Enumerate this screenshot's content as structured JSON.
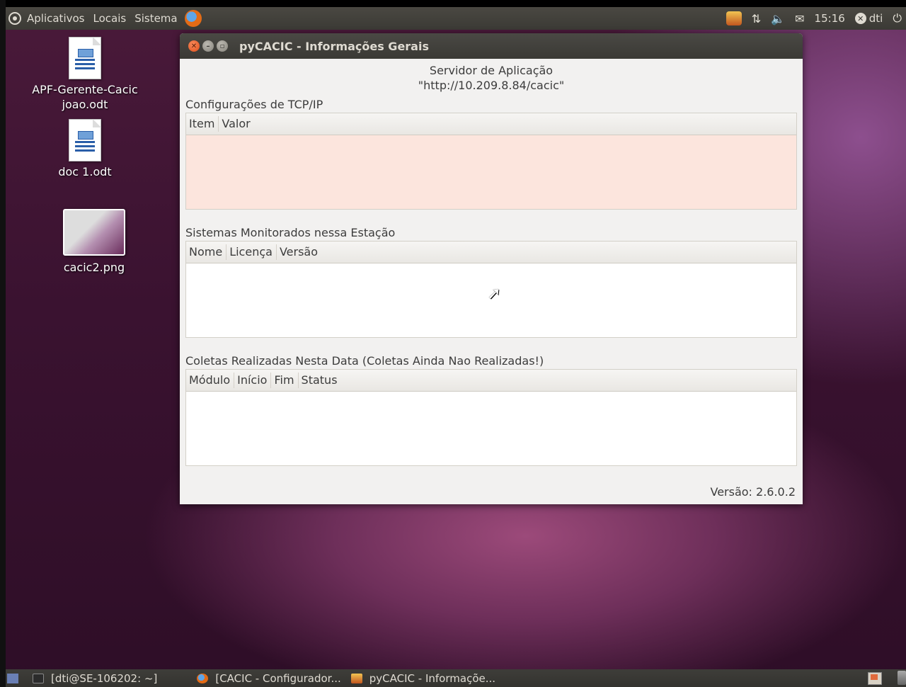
{
  "top_panel": {
    "menus": [
      "Aplicativos",
      "Locais",
      "Sistema"
    ],
    "clock": "15:16",
    "user": "dti"
  },
  "desktop": {
    "icons": [
      {
        "label_line1": "APF-Gerente-Cacic",
        "label_line2": "joao.odt"
      },
      {
        "label_line1": "doc 1.odt"
      },
      {
        "label_line1": "cacic2.png"
      }
    ]
  },
  "window": {
    "title": "pyCACIC - Informações Gerais",
    "server_label": "Servidor de Aplicação",
    "server_url": "\"http://10.209.8.84/cacic\"",
    "tcp_section": "Configurações de TCP/IP",
    "tcp_columns": [
      "Item",
      "Valor"
    ],
    "systems_section": "Sistemas Monitorados nessa Estação",
    "systems_columns": [
      "Nome",
      "Licença",
      "Versão"
    ],
    "collections_section": "Coletas Realizadas Nesta Data (Coletas Ainda Nao Realizadas!)",
    "collections_columns": [
      "Módulo",
      "Início",
      "Fim",
      "Status"
    ],
    "version": "Versão: 2.6.0.2"
  },
  "taskbar": {
    "tasks": [
      {
        "label": "[dti@SE-106202: ~]"
      },
      {
        "label": "[CACIC - Configurador..."
      },
      {
        "label": "pyCACIC - Informaçõe..."
      }
    ]
  },
  "colors": {
    "tcp_table_bg": "#fce5dd",
    "window_bg": "#f2f1f0",
    "titlebar": "#3a3935"
  }
}
